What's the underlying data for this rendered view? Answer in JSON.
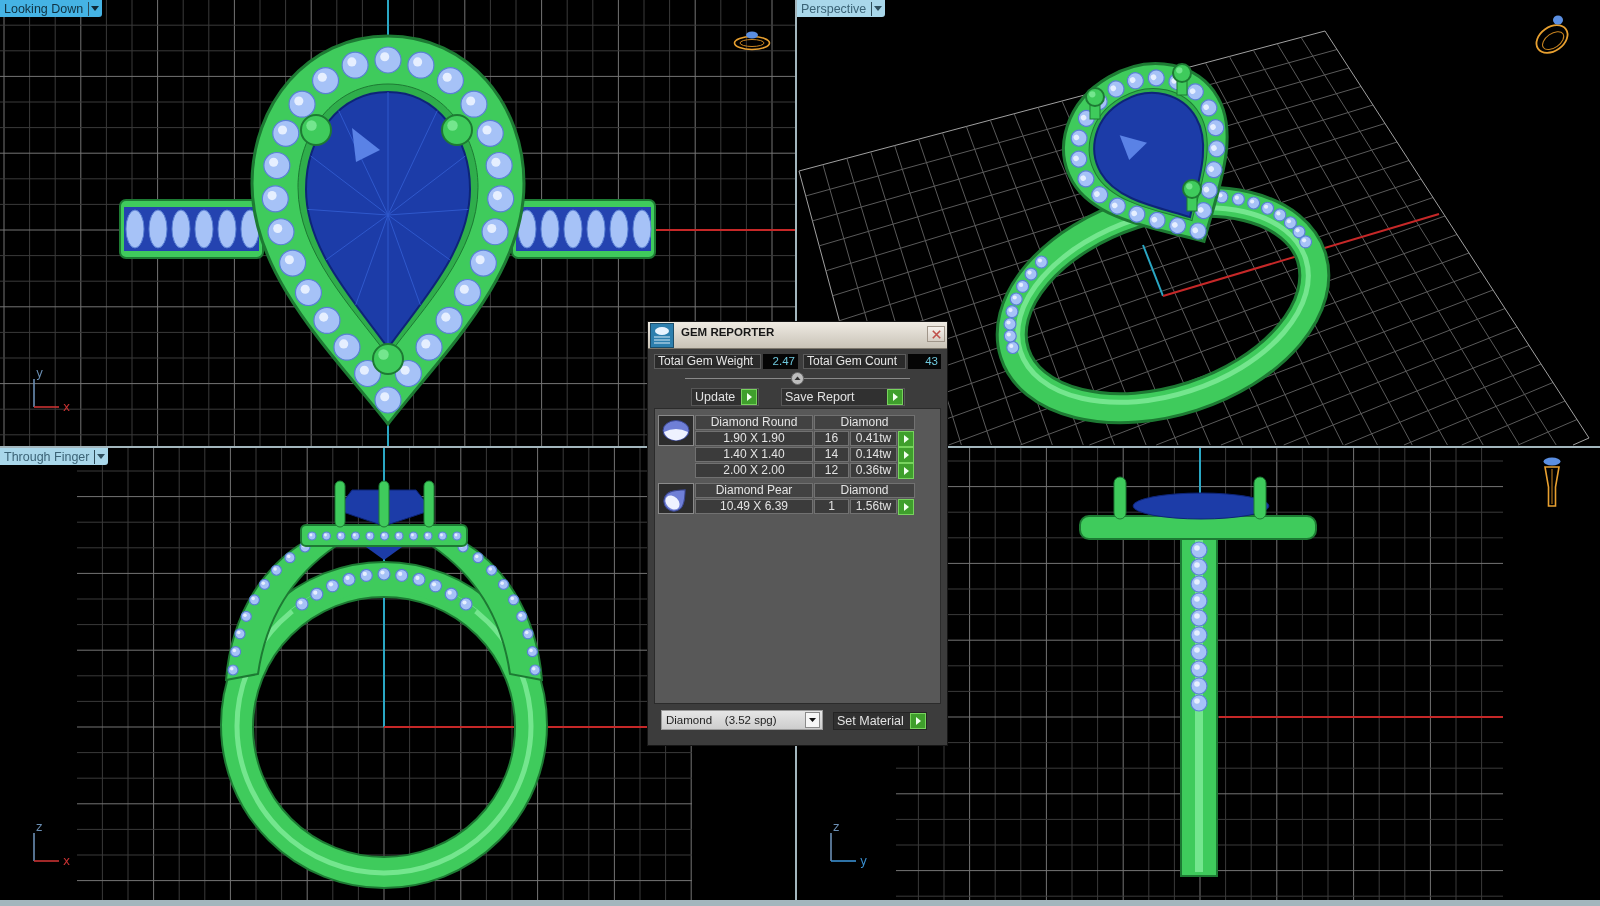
{
  "viewports": [
    {
      "kind": "top",
      "label": {
        "text": "Looking Down",
        "selected": true
      },
      "axes": {
        "vertical": {
          "label": "y",
          "color": "#6b8fb4"
        },
        "horizontal": {
          "label": "x",
          "color": "#c83232"
        }
      }
    },
    {
      "kind": "perspective",
      "label": {
        "text": "Perspective",
        "selected": false
      }
    },
    {
      "kind": "front",
      "label": {
        "text": "Through Finger",
        "selected": false
      },
      "axes": {
        "vertical": {
          "label": "z",
          "color": "#6b8fb4"
        },
        "horizontal": {
          "label": "x",
          "color": "#c83232"
        }
      }
    },
    {
      "kind": "side",
      "axes": {
        "vertical": {
          "label": "z",
          "color": "#6b8fb4"
        },
        "horizontal": {
          "label": "y",
          "color": "#3a8fd0"
        }
      }
    }
  ],
  "gem_reporter": {
    "title": "GEM REPORTER",
    "totals": [
      {
        "label": "Total Gem Weight",
        "value": "2.47"
      },
      {
        "label": "Total Gem Count",
        "value": "43"
      }
    ],
    "actions": [
      "Update",
      "Save Report"
    ],
    "groups": [
      {
        "kind": "round",
        "name": "Diamond Round",
        "material": "Diamond",
        "rows": [
          {
            "size": "1.90 X 1.90",
            "count": "16",
            "weight": "0.41tw"
          },
          {
            "size": "1.40 X 1.40",
            "count": "14",
            "weight": "0.14tw"
          },
          {
            "size": "2.00 X 2.00",
            "count": "12",
            "weight": "0.36tw"
          }
        ]
      },
      {
        "kind": "pear",
        "name": "Diamond Pear",
        "material": "Diamond",
        "rows": [
          {
            "size": "10.49 X 6.39",
            "count": "1",
            "weight": "1.56tw"
          }
        ]
      }
    ],
    "material_select": {
      "value": "Diamond    (3.52 spg)"
    },
    "set_material": "Set Material"
  }
}
